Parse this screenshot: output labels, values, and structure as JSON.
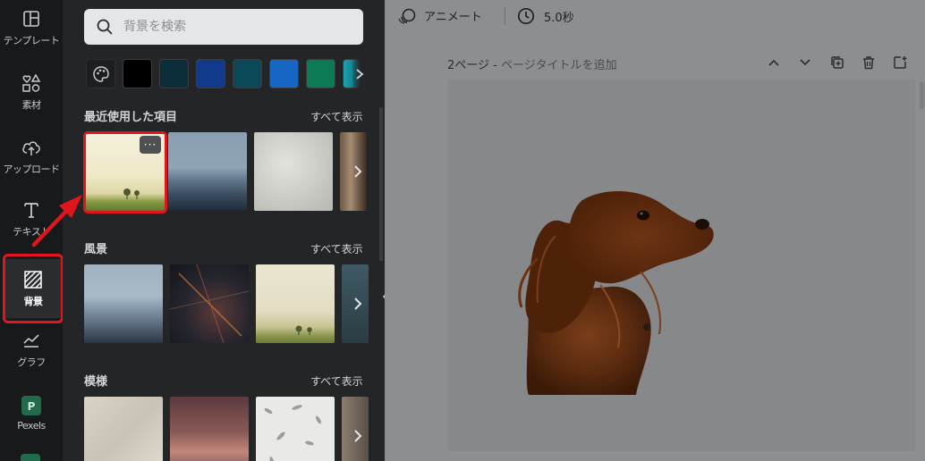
{
  "rail": {
    "items": [
      {
        "label": "テンプレート",
        "icon": "template-icon"
      },
      {
        "label": "素材",
        "icon": "elements-icon"
      },
      {
        "label": "アップロード",
        "icon": "upload-icon"
      },
      {
        "label": "テキスト",
        "icon": "text-icon"
      },
      {
        "label": "背景",
        "icon": "background-icon",
        "active": true
      },
      {
        "label": "グラフ",
        "icon": "chart-icon"
      },
      {
        "label": "Pexels",
        "icon": "pexels-icon"
      }
    ]
  },
  "panel": {
    "search": {
      "placeholder": "背景を検索"
    },
    "swatches": [
      "#000000",
      "#0c2d3a",
      "#113a8c",
      "#0d4a59",
      "#1766c4",
      "#0d7a56",
      "#1aa3b0"
    ],
    "sections": [
      {
        "title": "最近使用した項目",
        "see_all": "すべて表示"
      },
      {
        "title": "風景",
        "see_all": "すべて表示"
      },
      {
        "title": "模様",
        "see_all": "すべて表示"
      }
    ],
    "more_label": "···"
  },
  "editor": {
    "animate_label": "アニメート",
    "duration_label": "5.0秒",
    "page_label": "2ページ - ",
    "page_title_placeholder": "ページタイトルを追加"
  },
  "colors": {
    "highlight": "#e0161c",
    "panel_bg": "#242527",
    "rail_bg": "#18191b",
    "editor_bg": "#8d8e90"
  }
}
